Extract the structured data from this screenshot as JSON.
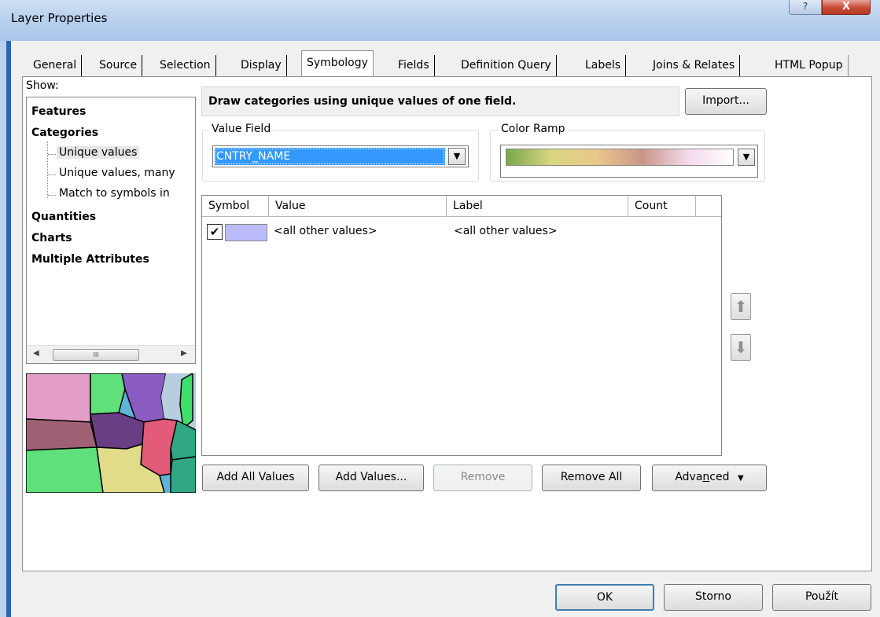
{
  "window": {
    "title": "Layer Properties",
    "help_label": "?",
    "close_label": "X"
  },
  "tabs": [
    {
      "label": "General"
    },
    {
      "label": "Source"
    },
    {
      "label": "Selection"
    },
    {
      "label": "Display"
    },
    {
      "label": "Symbology",
      "active": true
    },
    {
      "label": "Fields"
    },
    {
      "label": "Definition Query"
    },
    {
      "label": "Labels"
    },
    {
      "label": "Joins & Relates"
    },
    {
      "label": "HTML Popup"
    }
  ],
  "show": {
    "label": "Show:",
    "items": [
      {
        "label": "Features",
        "level": 0,
        "bold": true
      },
      {
        "label": "Categories",
        "level": 0,
        "bold": true
      },
      {
        "label": "Unique values",
        "level": 1,
        "selected": true
      },
      {
        "label": "Unique values, many",
        "level": 1
      },
      {
        "label": "Match to symbols in",
        "level": 1
      },
      {
        "label": "Quantities",
        "level": 0,
        "bold": true
      },
      {
        "label": "Charts",
        "level": 0,
        "bold": true
      },
      {
        "label": "Multiple Attributes",
        "level": 0,
        "bold": true
      }
    ],
    "scroll_thumb": "III"
  },
  "symbology": {
    "description": "Draw categories using unique values of one field.",
    "import_label": "Import...",
    "value_field": {
      "label": "Value Field",
      "value": "CNTRY_NAME"
    },
    "color_ramp": {
      "label": "Color Ramp",
      "colors": [
        "#7aa84d",
        "#d9d67f",
        "#e8c88c",
        "#c9958a",
        "#f3d9ea",
        "#ffffff"
      ]
    }
  },
  "table": {
    "columns": [
      "Symbol",
      "Value",
      "Label",
      "Count"
    ],
    "rows": [
      {
        "checked": true,
        "symbol_color": "#bbbbfa",
        "value": "<all other values>",
        "label": "<all other values>",
        "count": ""
      }
    ]
  },
  "actions": {
    "add_all": "Add All Values",
    "add_values": "Add Values...",
    "remove": "Remove",
    "remove_all": "Remove All",
    "advanced": "Advanced",
    "move_up_icon": "arrow-up-icon",
    "move_down_icon": "arrow-down-icon"
  },
  "footer": {
    "ok": "OK",
    "cancel": "Storno",
    "apply": "Použít"
  }
}
